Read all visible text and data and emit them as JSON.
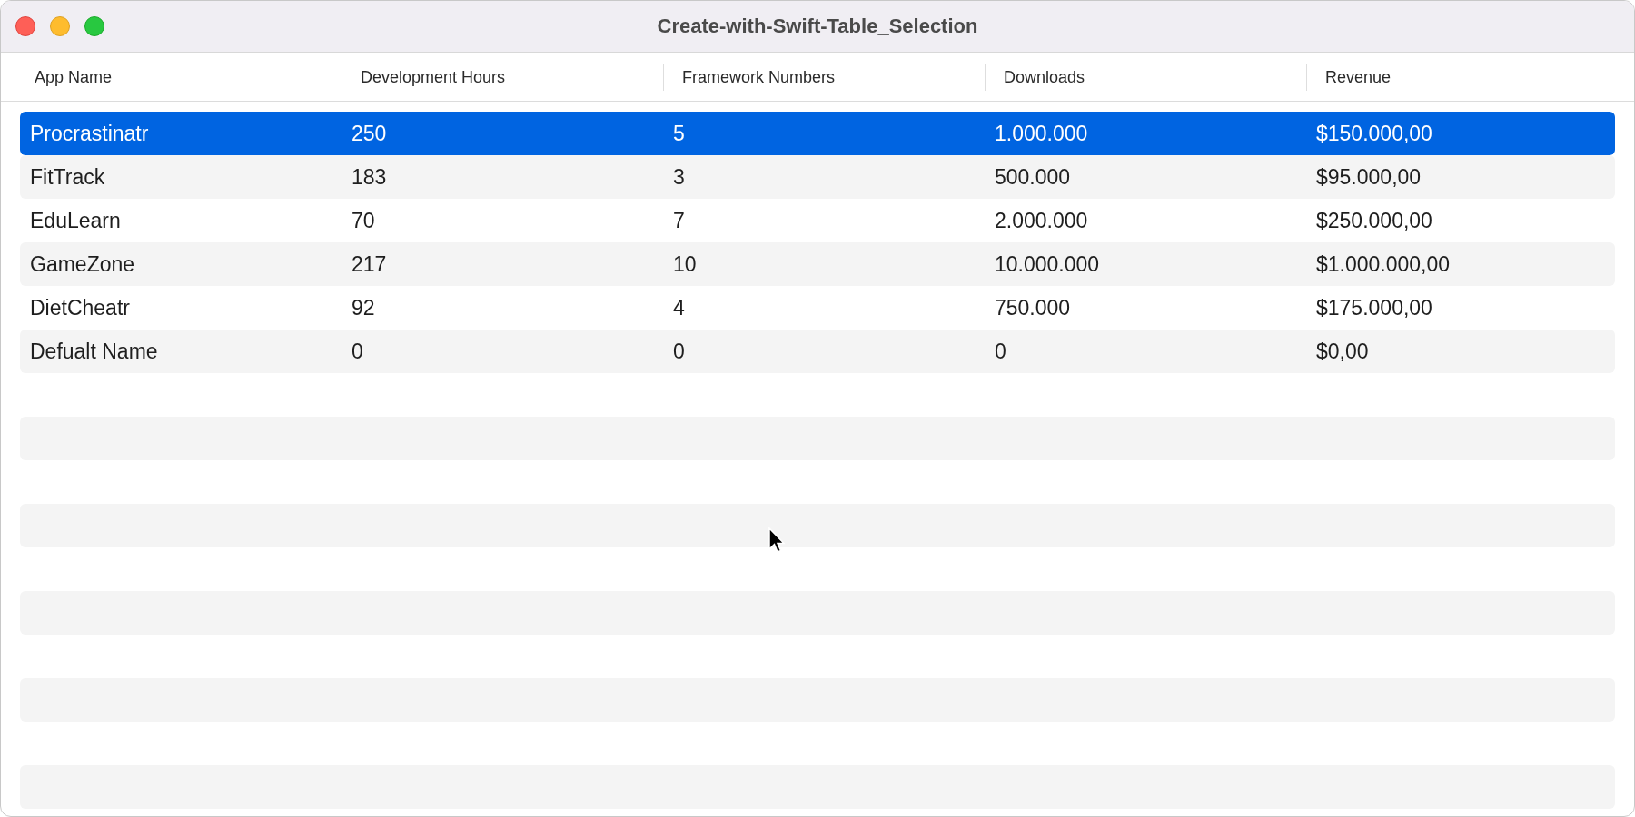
{
  "window": {
    "title": "Create-with-Swift-Table_Selection"
  },
  "table": {
    "columns": [
      "App Name",
      "Development Hours",
      "Framework Numbers",
      "Downloads",
      "Revenue"
    ],
    "rows": [
      {
        "cells": [
          "Procrastinatr",
          "250",
          "5",
          "1.000.000",
          "$150.000,00"
        ],
        "selected": true
      },
      {
        "cells": [
          "FitTrack",
          "183",
          "3",
          "500.000",
          "$95.000,00"
        ],
        "selected": false
      },
      {
        "cells": [
          "EduLearn",
          "70",
          "7",
          "2.000.000",
          "$250.000,00"
        ],
        "selected": false
      },
      {
        "cells": [
          "GameZone",
          "217",
          "10",
          "10.000.000",
          "$1.000.000,00"
        ],
        "selected": false
      },
      {
        "cells": [
          "DietCheatr",
          "92",
          "4",
          "750.000",
          "$175.000,00"
        ],
        "selected": false
      },
      {
        "cells": [
          "Defualt Name",
          "0",
          "0",
          "0",
          "$0,00"
        ],
        "selected": false
      }
    ]
  }
}
